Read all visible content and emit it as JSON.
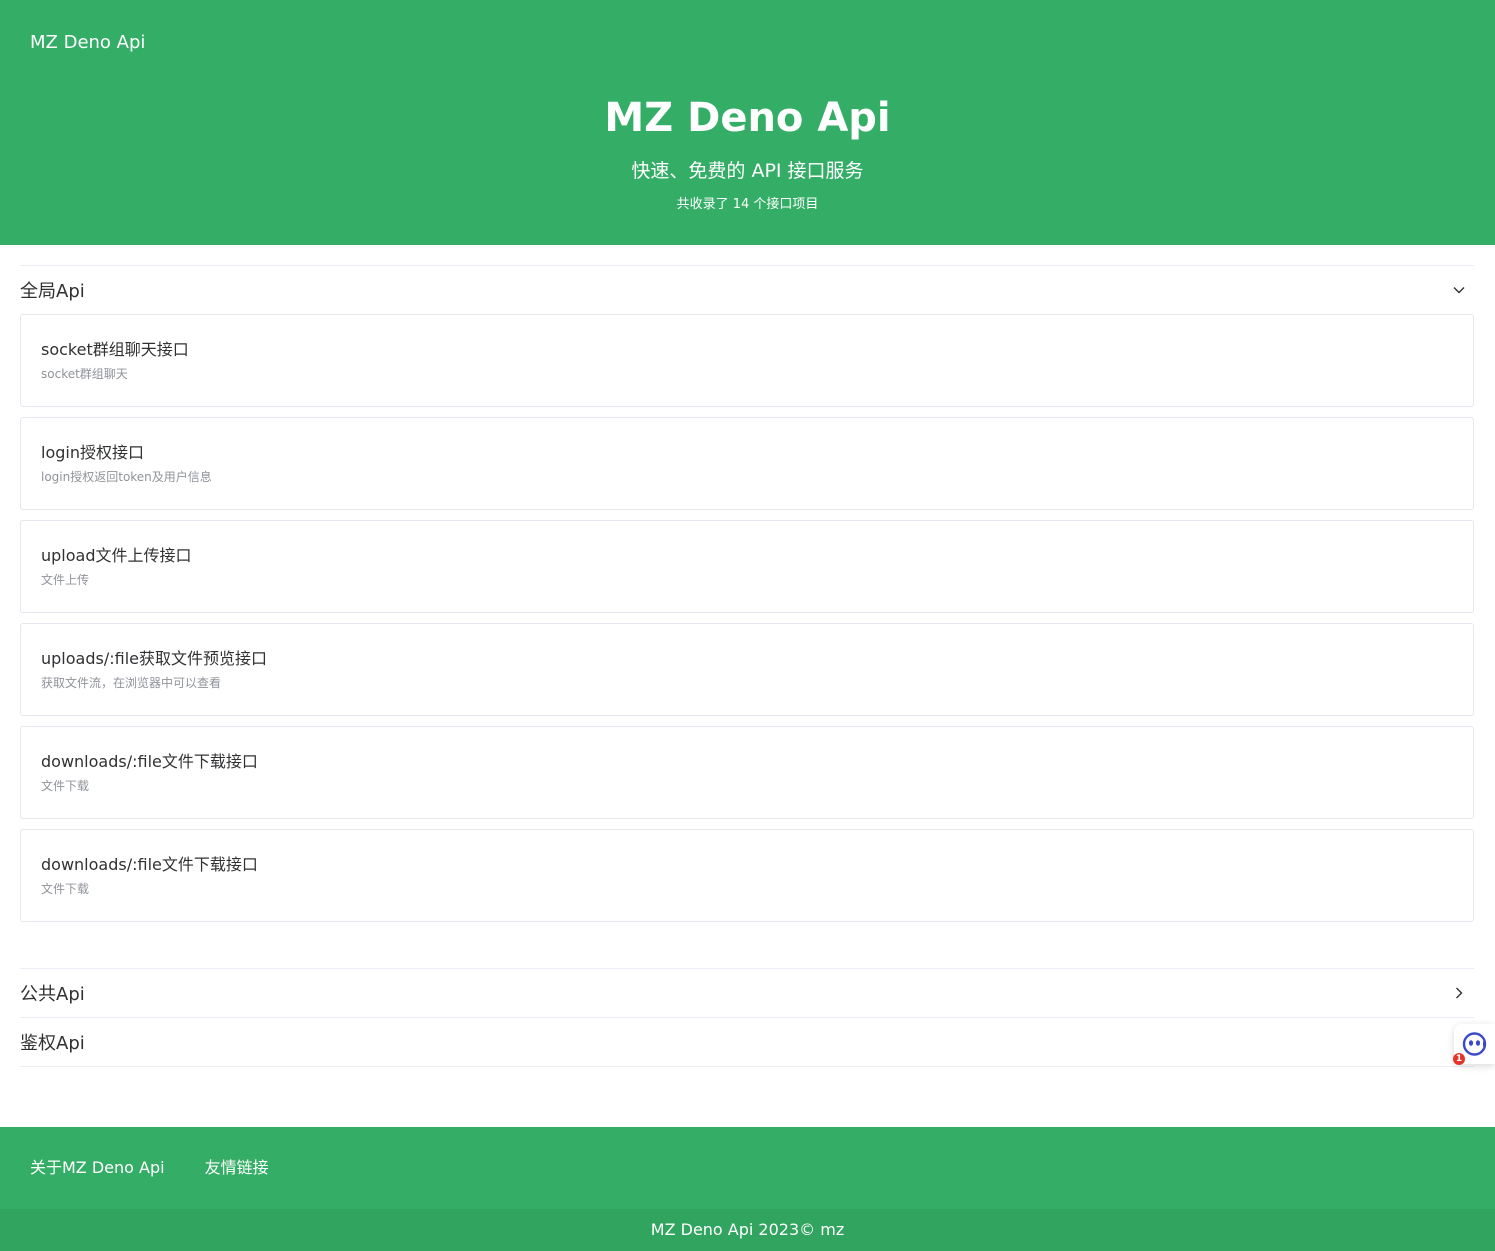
{
  "header": {
    "brand": "MZ Deno Api",
    "title": "MZ Deno Api",
    "subtitle": "快速、免费的 API 接口服务",
    "count_text": "共收录了 14 个接口项目"
  },
  "sections": [
    {
      "title": "全局Api",
      "expanded": true,
      "items": [
        {
          "title": "socket群组聊天接口",
          "desc": "socket群组聊天"
        },
        {
          "title": "login授权接口",
          "desc": "login授权返回token及用户信息"
        },
        {
          "title": "upload文件上传接口",
          "desc": "文件上传"
        },
        {
          "title": "uploads/:file获取文件预览接口",
          "desc": "获取文件流，在浏览器中可以查看"
        },
        {
          "title": "downloads/:file文件下载接口",
          "desc": "文件下载"
        },
        {
          "title": "downloads/:file文件下载接口",
          "desc": "文件下载"
        }
      ]
    },
    {
      "title": "公共Api",
      "expanded": false
    },
    {
      "title": "鉴权Api",
      "expanded": false
    }
  ],
  "float_widget": {
    "icon": "assistant-bot-icon",
    "badge": "1"
  },
  "footer": {
    "links": [
      "关于MZ Deno Api",
      "友情链接"
    ],
    "copyright": "MZ Deno Api 2023© mz"
  },
  "colors": {
    "primary": "#34ae66",
    "footer_bottom": "#31a45f",
    "badge": "#e3352b"
  }
}
